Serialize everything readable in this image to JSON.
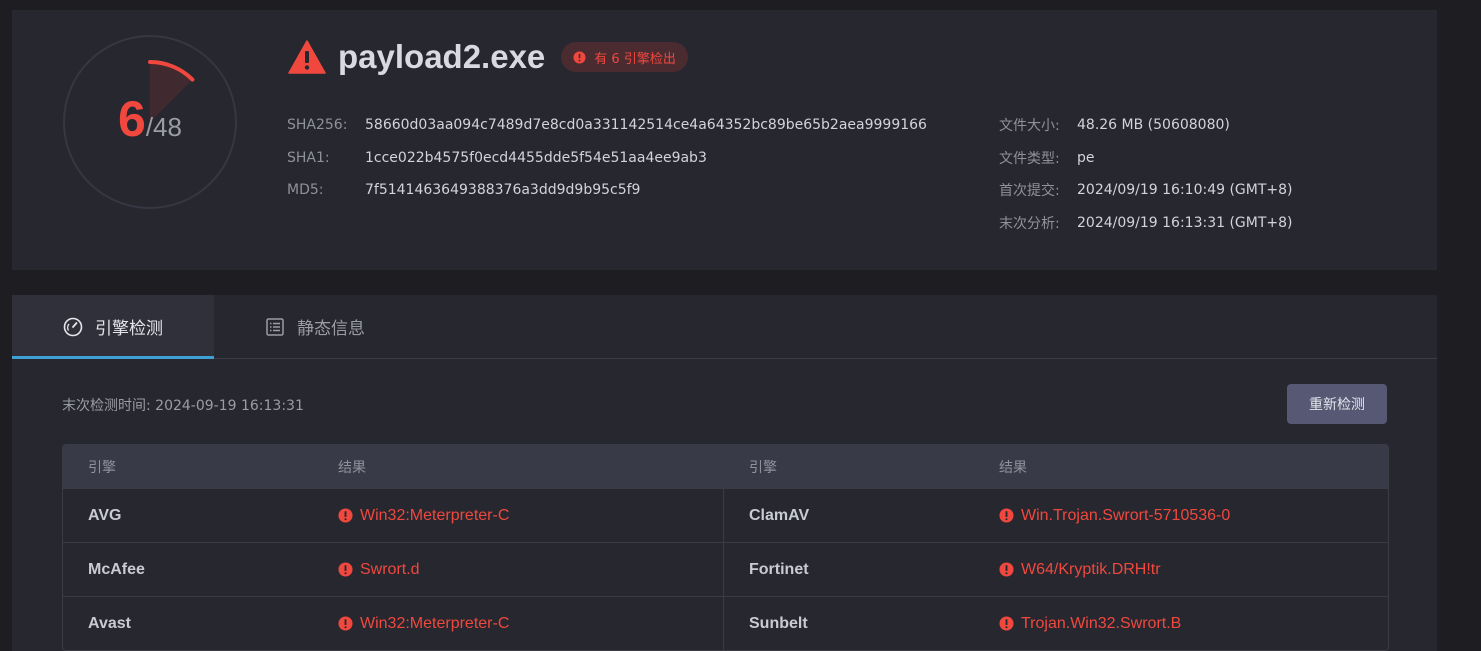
{
  "summary": {
    "detections": "6",
    "total": "/48",
    "detection_ratio": 0.125,
    "file_name": "payload2.exe",
    "badge": "有 6 引擎检出",
    "hashes": [
      {
        "label": "SHA256:",
        "value": "58660d03aa094c7489d7e8cd0a331142514ce4a64352bc89be65b2aea9999166"
      },
      {
        "label": "SHA1:",
        "value": "1cce022b4575f0ecd4455dde5f54e51aa4ee9ab3"
      },
      {
        "label": "MD5:",
        "value": "7f5141463649388376a3dd9d9b95c5f9"
      }
    ],
    "info": [
      {
        "label": "文件大小:",
        "value": "48.26 MB (50608080)"
      },
      {
        "label": "文件类型:",
        "value": "pe"
      },
      {
        "label": "首次提交:",
        "value": "2024/09/19 16:10:49 (GMT+8)"
      },
      {
        "label": "末次分析:",
        "value": "2024/09/19 16:13:31 (GMT+8)"
      }
    ]
  },
  "tabs": [
    {
      "label": "引擎检测",
      "icon": "gauge-icon",
      "active": true
    },
    {
      "label": "静态信息",
      "icon": "document-list-icon",
      "active": false
    }
  ],
  "scan": {
    "last_scan": "末次检测时间: 2024-09-19 16:13:31",
    "rescan_label": "重新检测"
  },
  "table": {
    "headers": [
      "引擎",
      "结果",
      "引擎",
      "结果"
    ],
    "rows": [
      {
        "engine1": "AVG",
        "result1": "Win32:Meterpreter-C",
        "engine2": "ClamAV",
        "result2": "Win.Trojan.Swrort-5710536-0"
      },
      {
        "engine1": "McAfee",
        "result1": "Swrort.d",
        "engine2": "Fortinet",
        "result2": "W64/Kryptik.DRH!tr"
      },
      {
        "engine1": "Avast",
        "result1": "Win32:Meterpreter-C",
        "engine2": "Sunbelt",
        "result2": "Trojan.Win32.Swrort.B"
      }
    ]
  },
  "colors": {
    "danger": "#f0483e",
    "accent": "#3ea0d6",
    "panel": "#27272f",
    "background": "#1d1d22"
  }
}
